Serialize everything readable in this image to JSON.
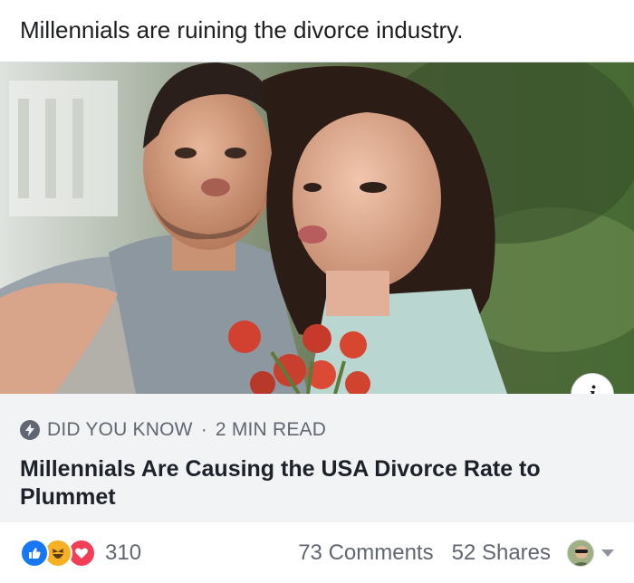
{
  "post": {
    "text": "Millennials are ruining the divorce industry."
  },
  "link": {
    "source_label": "DID YOU KNOW",
    "separator": "·",
    "read_time": "2 MIN READ",
    "headline": "Millennials Are Causing the USA Divorce Rate to Plummet",
    "info_glyph": "i"
  },
  "footer": {
    "reaction_count": "310",
    "comments": "73 Comments",
    "shares": "52 Shares",
    "reactions": [
      "like-icon",
      "haha-icon",
      "love-icon"
    ]
  },
  "colors": {
    "like": "#1877f2",
    "haha": "#f7b125",
    "love": "#f33e58",
    "meta_gray": "#606770",
    "caption_bg": "#f2f3f5"
  }
}
